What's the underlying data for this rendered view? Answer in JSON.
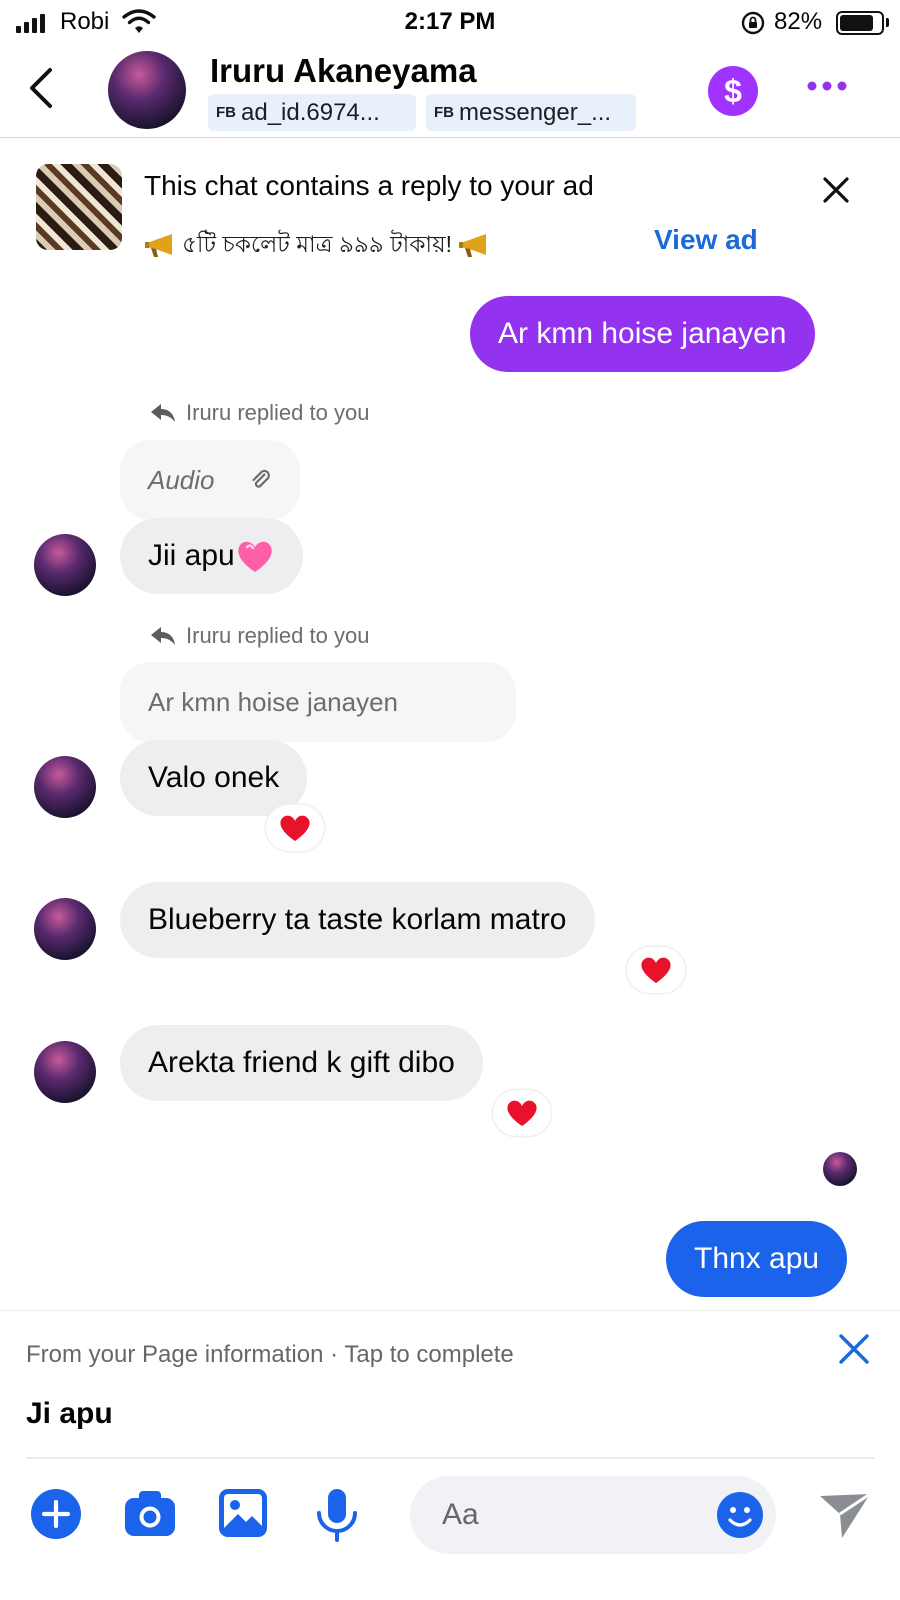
{
  "status_bar": {
    "carrier": "Robi",
    "time": "2:17 PM",
    "battery": "82%",
    "battery_level": 0.82
  },
  "header": {
    "contact_name": "Iruru Akaneyama",
    "chips": [
      {
        "prefix": "FB",
        "label": "ad_id.6974..."
      },
      {
        "prefix": "FB",
        "label": "messenger_..."
      }
    ],
    "payment_symbol": "$"
  },
  "ad_banner": {
    "title": "This chat contains a reply to your ad",
    "subtitle": "৫টি চকলেট মাত্র ৯৯৯ টাকায়!",
    "view_ad": "View ad"
  },
  "messages": {
    "m1": "Ar kmn hoise janayen",
    "reply_note_1": "Iruru replied to you",
    "quoted_1": "Audio",
    "m2": "Jii apu",
    "reply_note_2": "Iruru replied to you",
    "quoted_2": "Ar kmn hoise janayen",
    "m3": "Valo onek",
    "m4": "Blueberry ta taste korlam matro",
    "m5": "Arekta friend k gift dibo",
    "m6": "Thnx apu"
  },
  "suggestion": {
    "label": "From your Page information · Tap to complete",
    "text": "Ji apu"
  },
  "composer": {
    "placeholder": "Aa"
  },
  "colors": {
    "accent_purple": "#9333f0",
    "accent_blue": "#1c63eb",
    "link_blue": "#1a6ad8"
  }
}
